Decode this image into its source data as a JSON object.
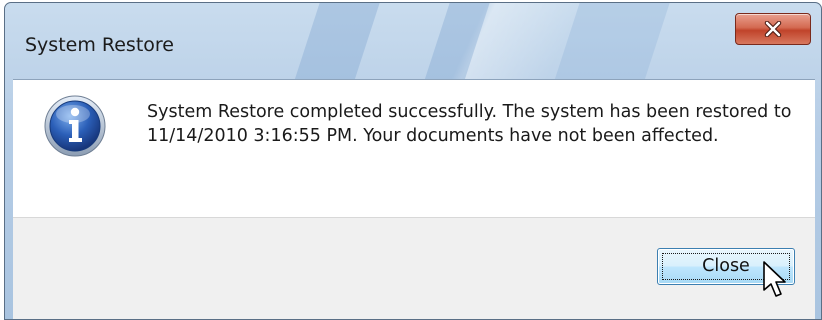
{
  "dialog": {
    "title": "System Restore",
    "message": "System Restore completed successfully. The system has been restored to 11/14/2010 3:16:55 PM. Your documents have not been affected.",
    "icon": "info-icon",
    "close_button_label": "Close"
  },
  "titlebar": {
    "close_icon": "close-icon"
  },
  "colors": {
    "titlebar": "#b6cde6",
    "close_x": "#c0432a",
    "button_border": "#3c7fb1",
    "info_icon": "#2250a3"
  }
}
